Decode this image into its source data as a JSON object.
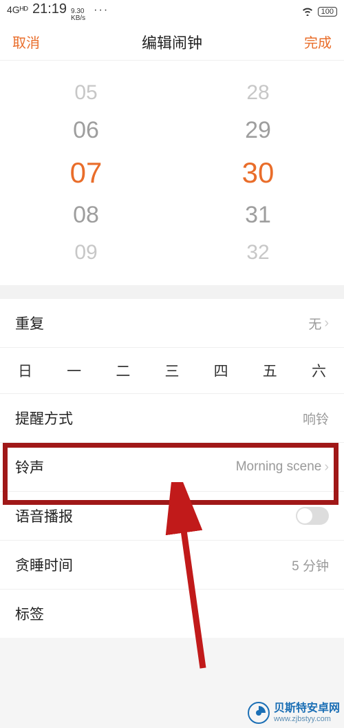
{
  "status": {
    "network": "4Gᴴᴰ",
    "time": "21:19",
    "kbs_top": "9.30",
    "kbs_bot": "KB/s",
    "battery": "100"
  },
  "nav": {
    "cancel": "取消",
    "title": "编辑闹钟",
    "done": "完成"
  },
  "picker": {
    "hours": [
      "05",
      "06",
      "07",
      "08",
      "09"
    ],
    "mins": [
      "28",
      "29",
      "30",
      "31",
      "32"
    ]
  },
  "repeat": {
    "label": "重复",
    "value": "无"
  },
  "days": [
    "日",
    "一",
    "二",
    "三",
    "四",
    "五",
    "六"
  ],
  "remind": {
    "label": "提醒方式",
    "value": "响铃"
  },
  "ring": {
    "label": "铃声",
    "value": "Morning scene"
  },
  "voice": {
    "label": "语音播报"
  },
  "snooze": {
    "label": "贪睡时间",
    "value": "5 分钟"
  },
  "tag": {
    "label": "标签"
  },
  "watermark": {
    "name": "贝斯特安卓网",
    "url": "www.zjbstyy.com"
  }
}
